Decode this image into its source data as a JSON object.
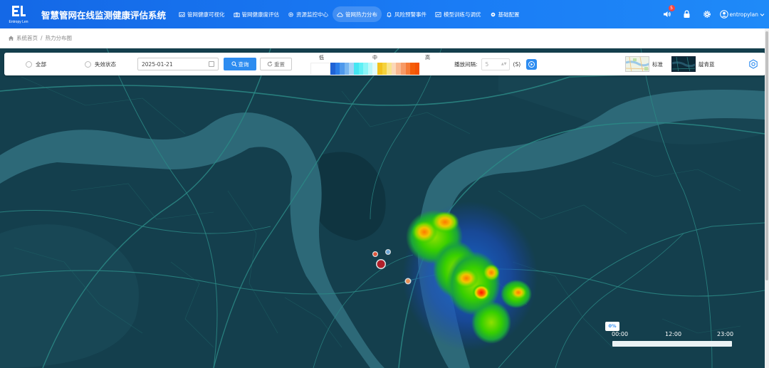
{
  "app": {
    "title": "智慧管网在线监测健康评估系统",
    "logo_text": "Entropy Len"
  },
  "nav": [
    {
      "label": "管网健康可视化",
      "icon": "image-icon"
    },
    {
      "label": "管网健康度评估",
      "icon": "camera-icon"
    },
    {
      "label": "资源监控中心",
      "icon": "gear-icon"
    },
    {
      "label": "管网热力分布",
      "icon": "cloud-icon",
      "active": true
    },
    {
      "label": "风险预警事件",
      "icon": "bell-icon"
    },
    {
      "label": "模型训练与调优",
      "icon": "chart-icon"
    },
    {
      "label": "基础配置",
      "icon": "settings-icon"
    }
  ],
  "header_right": {
    "notification_count": "5",
    "username": "entropylan"
  },
  "breadcrumb": {
    "home": "系统首页",
    "current": "热力分布图"
  },
  "filters": {
    "radio_all": "全部",
    "radio_invalid": "失效状态",
    "date_value": "2025-01-21",
    "query_label": "查询",
    "reset_label": "重置"
  },
  "legend": {
    "low": "低",
    "mid": "中",
    "high": "高",
    "colors": [
      "#ffffff",
      "#1f63d6",
      "#2a7de8",
      "#4f99ec",
      "#78b6f0",
      "#a6d3f5",
      "#44e6f2",
      "#5ef0f5",
      "#8bf5f7",
      "#bdf8f8",
      "#e3fbfa",
      "#f2c21c",
      "#f5d23c",
      "#f8e48c",
      "#fbd8b8",
      "#f9b890",
      "#f79a66",
      "#f67c38",
      "#f55d08",
      "#f45205"
    ]
  },
  "playback": {
    "label": "播放间隔:",
    "value": "5",
    "unit": "(S)"
  },
  "map_styles": {
    "standard": "标准",
    "dark_blue": "靛青蓝"
  },
  "timeline": {
    "percent": "0%",
    "ticks": [
      "00:00",
      "12:00",
      "23:00"
    ]
  }
}
